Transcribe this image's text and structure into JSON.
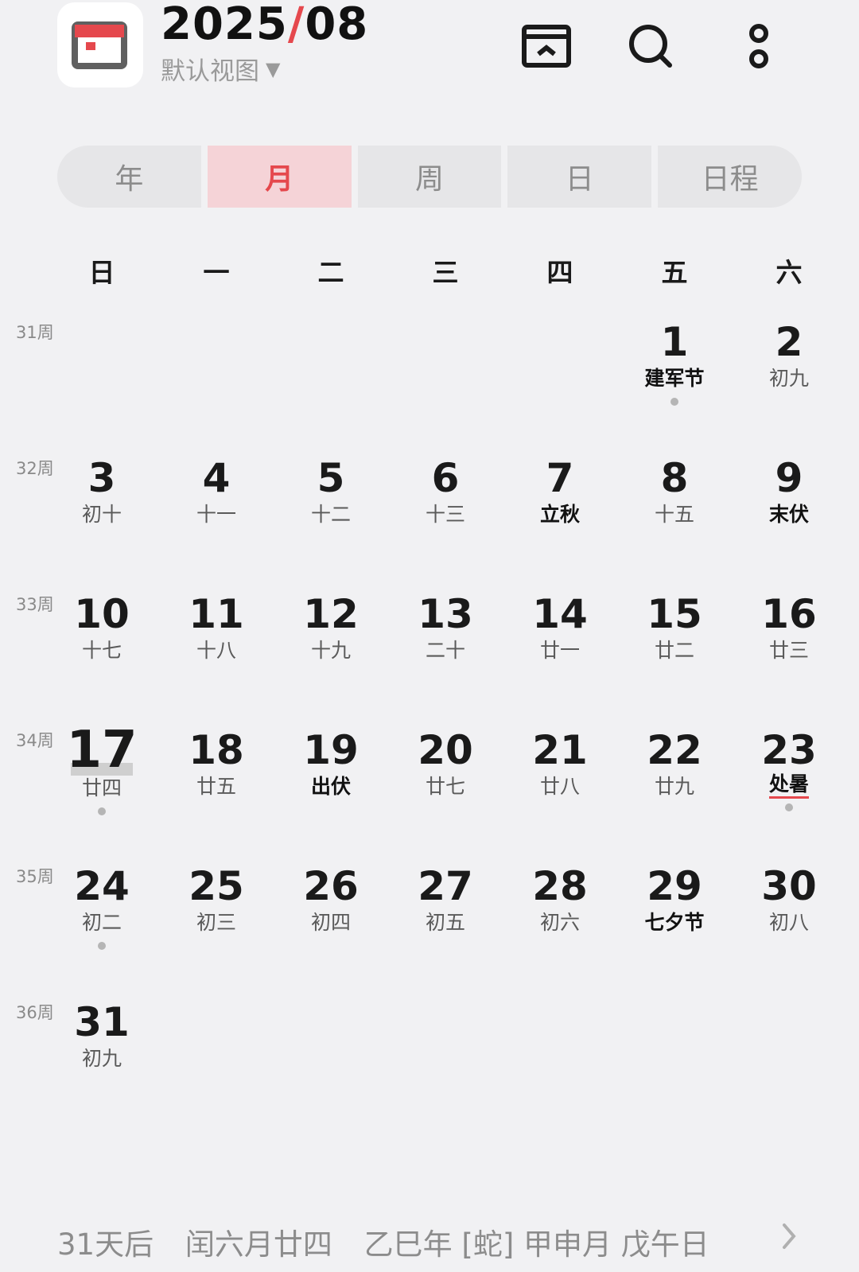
{
  "header": {
    "year": "2025",
    "slash": "/",
    "month": "08",
    "view_label": "默认视图",
    "view_caret": "▼",
    "colors": {
      "accent": "#e5484d"
    }
  },
  "toolbar": {
    "icons": [
      "today-icon",
      "search-icon",
      "more-icon"
    ]
  },
  "tabs": [
    {
      "label": "年",
      "active": false
    },
    {
      "label": "月",
      "active": true
    },
    {
      "label": "周",
      "active": false
    },
    {
      "label": "日",
      "active": false
    },
    {
      "label": "日程",
      "active": false
    }
  ],
  "weekdays": [
    "日",
    "一",
    "二",
    "三",
    "四",
    "五",
    "六"
  ],
  "weeks": [
    {
      "label": "31周",
      "days": [
        null,
        null,
        null,
        null,
        null,
        {
          "day": "1",
          "lunar": "建军节",
          "bold": true,
          "dot": true
        },
        {
          "day": "2",
          "lunar": "初九"
        }
      ]
    },
    {
      "label": "32周",
      "days": [
        {
          "day": "3",
          "lunar": "初十"
        },
        {
          "day": "4",
          "lunar": "十一"
        },
        {
          "day": "5",
          "lunar": "十二"
        },
        {
          "day": "6",
          "lunar": "十三"
        },
        {
          "day": "7",
          "lunar": "立秋",
          "bold": true
        },
        {
          "day": "8",
          "lunar": "十五"
        },
        {
          "day": "9",
          "lunar": "末伏",
          "bold": true
        }
      ]
    },
    {
      "label": "33周",
      "days": [
        {
          "day": "10",
          "lunar": "十七"
        },
        {
          "day": "11",
          "lunar": "十八"
        },
        {
          "day": "12",
          "lunar": "十九"
        },
        {
          "day": "13",
          "lunar": "二十"
        },
        {
          "day": "14",
          "lunar": "廿一"
        },
        {
          "day": "15",
          "lunar": "廿二"
        },
        {
          "day": "16",
          "lunar": "廿三"
        }
      ]
    },
    {
      "label": "34周",
      "days": [
        {
          "day": "17",
          "lunar": "廿四",
          "today": true,
          "dot": true
        },
        {
          "day": "18",
          "lunar": "廿五"
        },
        {
          "day": "19",
          "lunar": "出伏",
          "bold": true
        },
        {
          "day": "20",
          "lunar": "廿七"
        },
        {
          "day": "21",
          "lunar": "廿八"
        },
        {
          "day": "22",
          "lunar": "廿九"
        },
        {
          "day": "23",
          "lunar": "处暑",
          "bold": true,
          "underline": true,
          "dot": true
        }
      ]
    },
    {
      "label": "35周",
      "days": [
        {
          "day": "24",
          "lunar": "初二",
          "dot": true
        },
        {
          "day": "25",
          "lunar": "初三"
        },
        {
          "day": "26",
          "lunar": "初四"
        },
        {
          "day": "27",
          "lunar": "初五"
        },
        {
          "day": "28",
          "lunar": "初六"
        },
        {
          "day": "29",
          "lunar": "七夕节",
          "bold": true
        },
        {
          "day": "30",
          "lunar": "初八"
        }
      ]
    },
    {
      "label": "36周",
      "days": [
        {
          "day": "31",
          "lunar": "初九"
        },
        null,
        null,
        null,
        null,
        null,
        null
      ]
    }
  ],
  "footer": {
    "countdown": "31天后",
    "lunar_date": "闰六月廿四",
    "ganzhi": "乙巳年 [蛇] 甲申月 戊午日"
  }
}
